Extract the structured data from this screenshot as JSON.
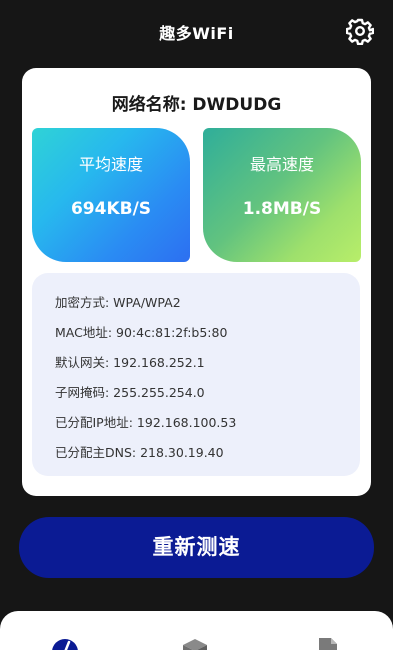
{
  "header": {
    "title": "趣多WiFi",
    "settings_icon": "gear-icon"
  },
  "network": {
    "name_label": "网络名称: DWDUDG"
  },
  "speed": {
    "average_label": "平均速度",
    "average_value": "694KB/S",
    "max_label": "最高速度",
    "max_value": "1.8MB/S"
  },
  "info": {
    "encryption": "加密方式: WPA/WPA2",
    "mac": "MAC地址: 90:4c:81:2f:b5:80",
    "gateway": "默认网关: 192.168.252.1",
    "subnet": "子网掩码: 255.255.254.0",
    "ip": "已分配IP地址: 192.168.100.53",
    "dns": "已分配主DNS: 218.30.19.40"
  },
  "actions": {
    "retest_label": "重新测速"
  },
  "tabbar": {
    "tabs": [
      {
        "icon": "speed-gauge-icon",
        "active": true
      },
      {
        "icon": "box-icon",
        "active": false
      },
      {
        "icon": "document-icon",
        "active": false
      }
    ]
  },
  "colors": {
    "background": "#161616",
    "button": "#0b1b94",
    "info_box": "#edf0fb",
    "active_tab": "#0b1b94",
    "inactive_tab": "#7a7a7a"
  }
}
